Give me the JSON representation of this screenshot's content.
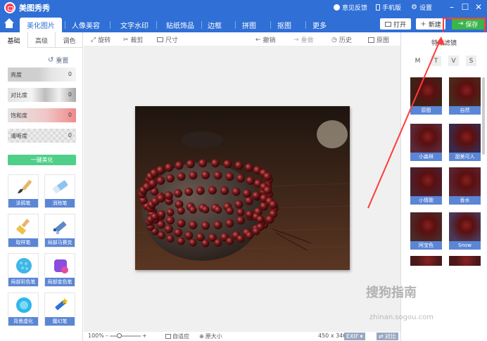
{
  "app": {
    "title": "美图秀秀"
  },
  "titlebar": {
    "feedback": "意见反馈",
    "mobile": "手机版",
    "settings": "设置"
  },
  "nav": {
    "tabs": [
      "美化图片",
      "人像美容",
      "文字水印",
      "贴纸饰品",
      "边框",
      "拼图",
      "抠图",
      "更多"
    ],
    "open": "打开",
    "new": "新建",
    "save": "保存"
  },
  "left": {
    "tabs": [
      "基础",
      "高级",
      "调色"
    ],
    "reset": "重置",
    "sliders": [
      {
        "label": "亮度",
        "value": "0"
      },
      {
        "label": "对比度",
        "value": "0"
      },
      {
        "label": "饱和度",
        "value": "0"
      },
      {
        "label": "清晰度",
        "value": "0"
      }
    ],
    "one_key": "一键美化",
    "tools": [
      "涂鸦笔",
      "消除笔",
      "取样笔",
      "局部马赛克",
      "局部彩色笔",
      "局部变色笔",
      "背景虚化",
      "魔幻笔"
    ]
  },
  "toolbar": {
    "rotate": "旋转",
    "crop": "裁剪",
    "size": "尺寸",
    "undo": "撤销",
    "redo": "重做",
    "history": "历史",
    "original": "原图"
  },
  "bottom": {
    "zoom": "100%",
    "fit": "自适应",
    "actual": "原大小",
    "dims": "450 x 346",
    "exif": "EXIF",
    "compare": "对比"
  },
  "filters": {
    "title": "特效滤镜",
    "categories": [
      "M",
      "T",
      "V",
      "S"
    ],
    "items": [
      "原图",
      "自然",
      "小森林",
      "甜美可人",
      "小情歌",
      "香水",
      "阿宝色",
      "Snow"
    ]
  },
  "watermark": {
    "brand": "搜狗指南",
    "url": "zhinan.sogou.com"
  }
}
